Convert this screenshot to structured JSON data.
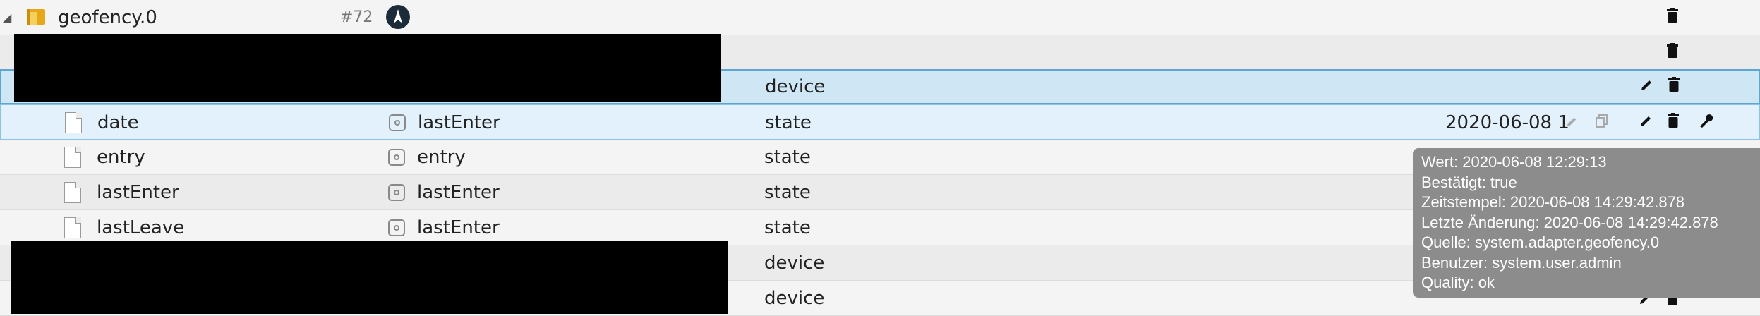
{
  "tree": {
    "root": {
      "name": "geofency.0",
      "id_badge": "#72"
    },
    "rows": [
      {
        "id": "date",
        "name": "lastEnter",
        "type": "state",
        "value": "2020-06-08 1"
      },
      {
        "id": "entry",
        "name": "entry",
        "type": "state",
        "value": ""
      },
      {
        "id": "lastEnter",
        "name": "lastEnter",
        "type": "state",
        "value": ""
      },
      {
        "id": "lastLeave",
        "name": "lastEnter",
        "type": "state",
        "value": ""
      }
    ],
    "device_label": "device"
  },
  "tooltip": {
    "lines": [
      "Wert: 2020-06-08 12:29:13",
      "Bestätigt: true",
      "Zeitstempel: 2020-06-08 14:29:42.878",
      "Letzte Änderung: 2020-06-08 14:29:42.878",
      "Quelle: system.adapter.geofency.0",
      "Benutzer: system.user.admin",
      "Quality: ok"
    ]
  },
  "icons": {
    "delete": "trash-icon",
    "edit": "pencil-icon",
    "copy": "copy-icon",
    "settings": "wrench-icon"
  },
  "colors": {
    "selection_parent": "#cfe7f5",
    "selection_row": "#e2f1fb",
    "tooltip_bg": "#8c8c8c"
  }
}
